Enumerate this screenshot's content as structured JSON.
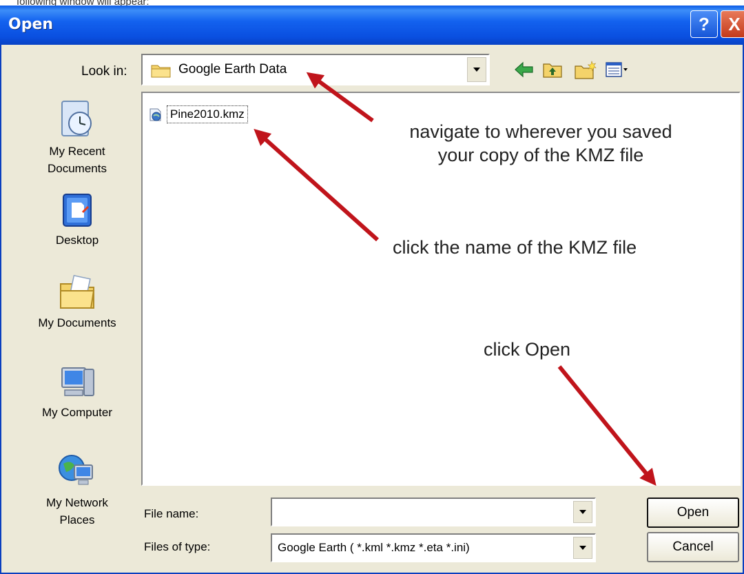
{
  "page_caption": "following window will appear:",
  "dialog": {
    "title": "Open",
    "help_label": "?",
    "close_label": "X"
  },
  "toolbar": {
    "look_in_label": "Look in:",
    "look_in_value": "Google Earth Data",
    "icons": [
      "back-arrow-icon",
      "up-folder-icon",
      "new-folder-icon",
      "views-menu-icon"
    ]
  },
  "places": [
    {
      "label_line1": "My Recent",
      "label_line2": "Documents",
      "icon": "recent-documents-icon"
    },
    {
      "label_line1": "Desktop",
      "label_line2": "",
      "icon": "desktop-icon"
    },
    {
      "label_line1": "My Documents",
      "label_line2": "",
      "icon": "my-documents-icon"
    },
    {
      "label_line1": "My Computer",
      "label_line2": "",
      "icon": "my-computer-icon"
    },
    {
      "label_line1": "My Network",
      "label_line2": "Places",
      "icon": "network-places-icon"
    }
  ],
  "files": [
    {
      "name": "Pine2010.kmz",
      "icon": "kmz-file-icon"
    }
  ],
  "annotations": {
    "navigate_line1": "navigate to wherever you saved",
    "navigate_line2": "your copy of the KMZ file",
    "click_name": "click the name of the KMZ file",
    "click_open": "click Open",
    "arrow_color": "#c0141b"
  },
  "bottom": {
    "file_name_label": "File name:",
    "file_name_value": "",
    "files_of_type_label": "Files of type:",
    "files_of_type_value": "Google Earth ( *.kml *.kmz *.eta *.ini)",
    "open_label": "Open",
    "cancel_label": "Cancel"
  }
}
